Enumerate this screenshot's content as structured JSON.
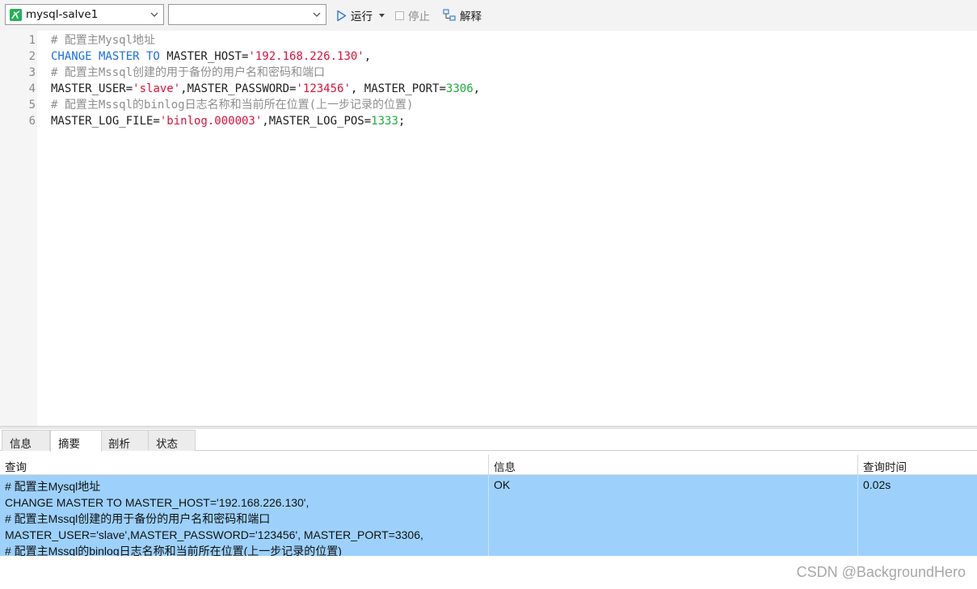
{
  "toolbar": {
    "connection": "mysql-salve1",
    "database": "",
    "run_label": "运行",
    "stop_label": "停止",
    "explain_label": "解释"
  },
  "editor": {
    "lines": [
      {
        "no": "1",
        "tokens": [
          {
            "t": "# 配置主Mysql地址",
            "k": "comment"
          }
        ]
      },
      {
        "no": "2",
        "tokens": [
          {
            "t": "CHANGE MASTER TO",
            "k": "kw"
          },
          {
            "t": " MASTER_HOST=",
            "k": "plain"
          },
          {
            "t": "'192.168.226.130'",
            "k": "str"
          },
          {
            "t": ",",
            "k": "plain"
          }
        ]
      },
      {
        "no": "3",
        "tokens": [
          {
            "t": "# 配置主Mssql创建的用于备份的用户名和密码和端口",
            "k": "comment"
          }
        ]
      },
      {
        "no": "4",
        "tokens": [
          {
            "t": "MASTER_USER=",
            "k": "plain"
          },
          {
            "t": "'slave'",
            "k": "str"
          },
          {
            "t": ",MASTER_PASSWORD=",
            "k": "plain"
          },
          {
            "t": "'123456'",
            "k": "str"
          },
          {
            "t": ", MASTER_PORT=",
            "k": "plain"
          },
          {
            "t": "3306",
            "k": "num"
          },
          {
            "t": ",",
            "k": "plain"
          }
        ]
      },
      {
        "no": "5",
        "tokens": [
          {
            "t": "# 配置主Mssql的binlog日志名称和当前所在位置(上一步记录的位置)",
            "k": "comment"
          }
        ]
      },
      {
        "no": "6",
        "tokens": [
          {
            "t": "MASTER_LOG_FILE=",
            "k": "plain"
          },
          {
            "t": "'binlog.000003'",
            "k": "str"
          },
          {
            "t": ",MASTER_LOG_POS=",
            "k": "plain"
          },
          {
            "t": "1333",
            "k": "num"
          },
          {
            "t": ";",
            "k": "plain"
          }
        ]
      }
    ]
  },
  "tabs": [
    {
      "label": "信息",
      "active": false
    },
    {
      "label": "摘要",
      "active": true
    },
    {
      "label": "剖析",
      "active": false
    },
    {
      "label": "状态",
      "active": false
    }
  ],
  "results": {
    "columns": [
      "查询",
      "信息",
      "查询时间"
    ],
    "row": {
      "query_lines": [
        "# 配置主Mysql地址",
        "CHANGE MASTER TO MASTER_HOST='192.168.226.130',",
        "# 配置主Mssql创建的用于备份的用户名和密码和端口",
        "MASTER_USER='slave',MASTER_PASSWORD='123456', MASTER_PORT=3306,",
        "# 配置主Mssql的binlog日志名称和当前所在位置(上一步记录的位置)"
      ],
      "info": "OK",
      "time": "0.02s"
    }
  },
  "watermark": "CSDN @BackgroundHero",
  "colors": {
    "comment": "#8e8e8e",
    "keyword": "#1a6ee6",
    "string": "#e0103a",
    "number": "#1eaa3c",
    "selected_row": "#9dd1fb",
    "connection_icon": "#1fb254"
  }
}
